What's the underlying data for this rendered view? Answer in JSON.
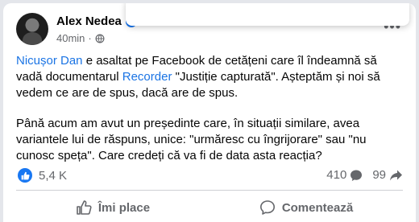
{
  "post": {
    "author": "Alex Nedea",
    "timestamp": "40min",
    "separator": "·",
    "privacy_icon": "globe-icon",
    "more_icon": "more-options-icon",
    "paragraph1": {
      "mention1": "Nicușor Dan",
      "text1": " e asaltat pe Facebook de cetățeni care îl îndeamnă să vadă documentarul ",
      "mention2": "Recorder",
      "text2": " \"Justiție capturată\". Așteptăm și noi să vedem ce are de spus, dacă are de spus."
    },
    "paragraph2": "Până acum am avut un președinte care, în situații similare, avea variantele lui de răspuns, unice: \"urmăresc cu îngrijorare\" sau \"nu cunosc speța\". Care credeți că va fi de data asta reacția?"
  },
  "stats": {
    "reactions": "5,4 K",
    "comments": "410",
    "shares": "99"
  },
  "actions": {
    "like_label": "Îmi place",
    "comment_label": "Comentează"
  },
  "colors": {
    "accent": "#1877f2",
    "mention": "#1b74e4",
    "muted": "#65676b"
  }
}
